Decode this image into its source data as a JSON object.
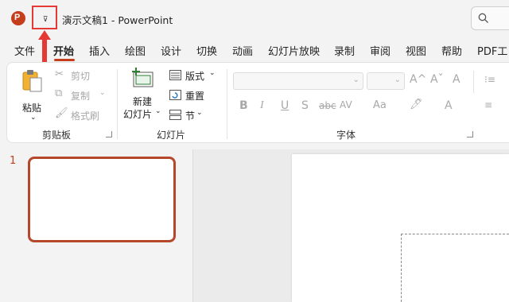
{
  "titlebar": {
    "app_icon_letter": "P",
    "qat_dropdown_glyph": "⊽",
    "doc_title": "演示文稿1  -  PowerPoint",
    "search_icon": "search-icon"
  },
  "tabs": [
    {
      "label": "文件",
      "active": false
    },
    {
      "label": "开始",
      "active": true
    },
    {
      "label": "插入",
      "active": false
    },
    {
      "label": "绘图",
      "active": false
    },
    {
      "label": "设计",
      "active": false
    },
    {
      "label": "切换",
      "active": false
    },
    {
      "label": "动画",
      "active": false
    },
    {
      "label": "幻灯片放映",
      "active": false
    },
    {
      "label": "录制",
      "active": false
    },
    {
      "label": "审阅",
      "active": false
    },
    {
      "label": "视图",
      "active": false
    },
    {
      "label": "帮助",
      "active": false
    },
    {
      "label": "PDF工",
      "active": false
    }
  ],
  "ribbon": {
    "clipboard": {
      "paste_label": "粘贴",
      "cut_label": "剪切",
      "copy_label": "复制",
      "format_painter_label": "格式刷",
      "group_label": "剪贴板"
    },
    "slides": {
      "new_slide_label_line1": "新建",
      "new_slide_label_line2": "幻灯片",
      "layout_label": "版式",
      "reset_label": "重置",
      "section_label": "节",
      "group_label": "幻灯片"
    },
    "font": {
      "font_name_value": "",
      "font_size_value": "",
      "grow_glyph": "A^",
      "shrink_glyph": "Aˇ",
      "clear_glyph": "A",
      "bold": "B",
      "italic": "I",
      "underline": "U",
      "shadow": "S",
      "strike": "abc",
      "spacing": "AV",
      "case": "Aa",
      "highlight": "🖊",
      "color": "A",
      "group_label": "字体"
    }
  },
  "slide_pane": {
    "slide_number": "1"
  },
  "colors": {
    "accent": "#c43e1c",
    "annotation": "#e53935"
  }
}
